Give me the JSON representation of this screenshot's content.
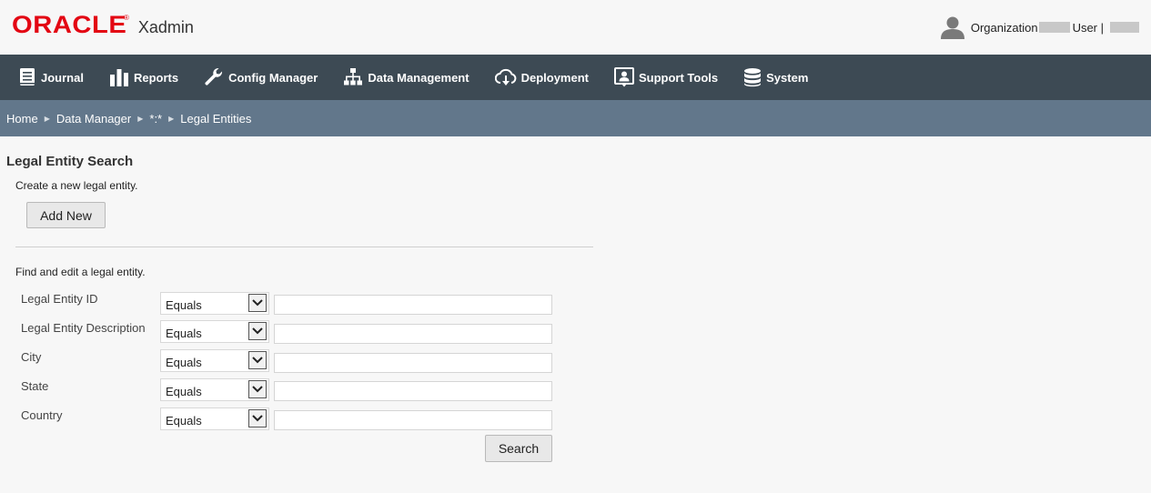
{
  "header": {
    "brand": "ORACLE",
    "brand_mark": "®",
    "app_name": "Xadmin",
    "user": {
      "org_label": "Organization",
      "user_label": "User |",
      "avatar_icon": "user-avatar-icon"
    }
  },
  "nav": {
    "items": [
      {
        "label": "Journal",
        "icon": "journal-icon"
      },
      {
        "label": "Reports",
        "icon": "bar-chart-icon"
      },
      {
        "label": "Config Manager",
        "icon": "wrench-icon"
      },
      {
        "label": "Data Management",
        "icon": "hierarchy-icon"
      },
      {
        "label": "Deployment",
        "icon": "cloud-download-icon"
      },
      {
        "label": "Support Tools",
        "icon": "support-icon"
      },
      {
        "label": "System",
        "icon": "database-icon"
      }
    ]
  },
  "breadcrumb": {
    "items": [
      "Home",
      "Data Manager",
      "*:*",
      "Legal Entities"
    ]
  },
  "main": {
    "title": "Legal Entity Search",
    "create_text": "Create a new legal entity.",
    "add_new_label": "Add New",
    "find_text": "Find and edit a legal entity.",
    "fields": [
      {
        "label": "Legal Entity ID",
        "operator": "Equals",
        "value": ""
      },
      {
        "label": "Legal Entity Description",
        "operator": "Equals",
        "value": ""
      },
      {
        "label": "City",
        "operator": "Equals",
        "value": ""
      },
      {
        "label": "State",
        "operator": "Equals",
        "value": ""
      },
      {
        "label": "Country",
        "operator": "Equals",
        "value": ""
      }
    ],
    "search_label": "Search"
  },
  "colors": {
    "brand_red": "#e30613",
    "navbar_bg": "#3d4a54",
    "breadcrumb_bg": "#62778b",
    "page_bg": "#f7f7f7"
  }
}
